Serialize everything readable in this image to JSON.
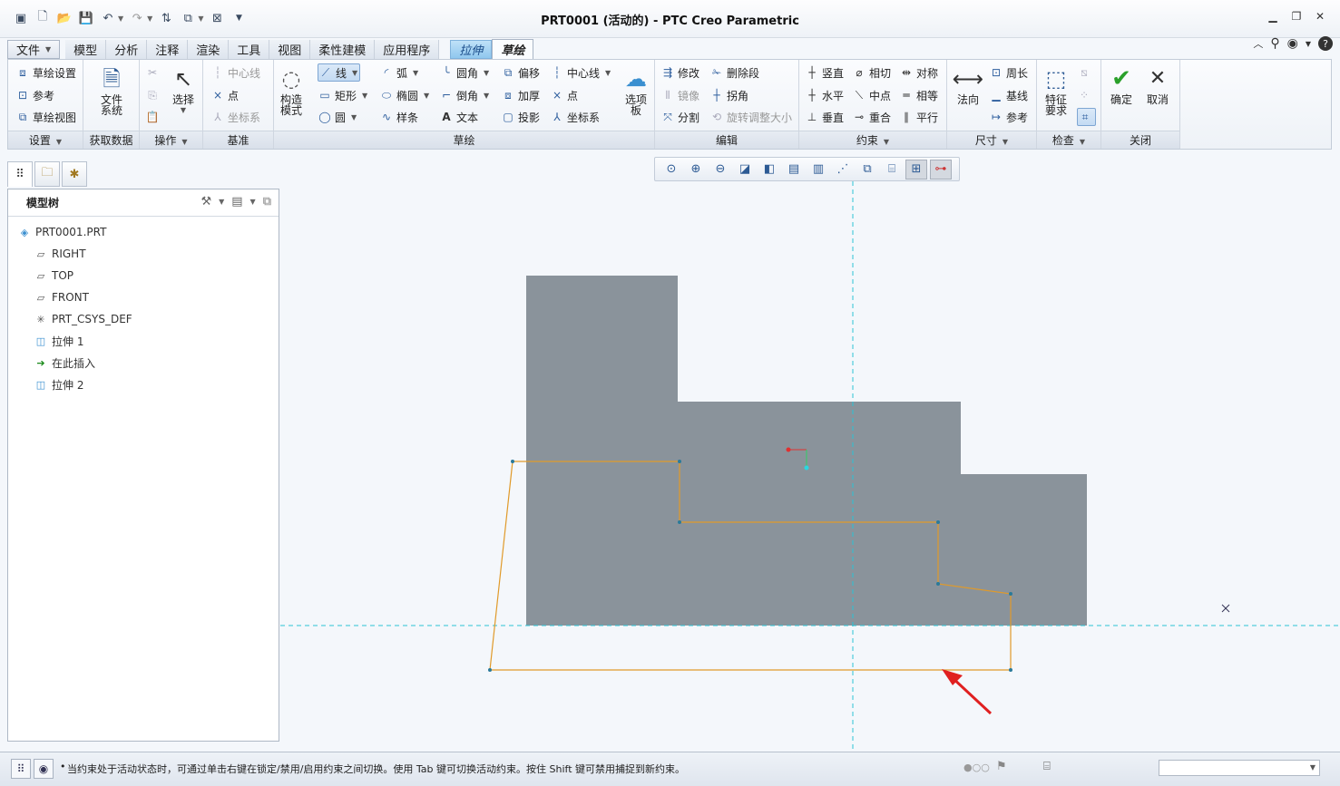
{
  "window": {
    "title": "PRT0001 (活动的) - PTC Creo Parametric"
  },
  "menu_tabs": [
    {
      "label": "文件",
      "dropdown": true
    },
    {
      "label": "模型"
    },
    {
      "label": "分析"
    },
    {
      "label": "注释"
    },
    {
      "label": "渲染"
    },
    {
      "label": "工具"
    },
    {
      "label": "视图"
    },
    {
      "label": "柔性建模"
    },
    {
      "label": "应用程序"
    },
    {
      "label": "拉伸",
      "contextual": true
    },
    {
      "label": "草绘",
      "active": true
    }
  ],
  "ribbon": {
    "setup": {
      "label": "设置",
      "items": [
        "草绘设置",
        "参考",
        "草绘视图"
      ]
    },
    "get_data": {
      "label": "获取数据",
      "file_system_l1": "文件",
      "file_system_l2": "系统"
    },
    "operations": {
      "label": "操作",
      "select_label": "选择"
    },
    "datum": {
      "label": "基准",
      "items": [
        "中心线",
        "点",
        "坐标系"
      ]
    },
    "sketching": {
      "label": "草绘",
      "construction_mode_l1": "构造",
      "construction_mode_l2": "模式",
      "col1": [
        "线",
        "矩形",
        "圆"
      ],
      "col2": [
        "弧",
        "椭圆",
        "样条"
      ],
      "col3": [
        "圆角",
        "倒角",
        "文本"
      ],
      "col4": [
        "偏移",
        "加厚",
        "投影"
      ],
      "col5": [
        "中心线",
        "点",
        "坐标系"
      ],
      "palette_l1": "选项",
      "palette_l2": "板"
    },
    "editing": {
      "label": "编辑",
      "items": [
        "修改",
        "删除段",
        "镜像",
        "拐角",
        "分割",
        "旋转调整大小"
      ]
    },
    "constrain": {
      "label": "约束",
      "items": [
        "竖直",
        "相切",
        "对称",
        "水平",
        "中点",
        "相等",
        "垂直",
        "重合",
        "平行"
      ]
    },
    "dimension": {
      "label": "尺寸",
      "normal": "法向",
      "items": [
        "周长",
        "基线",
        "参考"
      ]
    },
    "inspect": {
      "label": "检查",
      "feature_req_l1": "特征",
      "feature_req_l2": "要求"
    },
    "close": {
      "label": "关闭",
      "ok": "确定",
      "cancel": "取消"
    }
  },
  "model_tree": {
    "title": "模型树",
    "items": [
      {
        "label": "PRT0001.PRT",
        "icon": "part-icon"
      },
      {
        "label": "RIGHT",
        "icon": "datum-plane-icon"
      },
      {
        "label": "TOP",
        "icon": "datum-plane-icon"
      },
      {
        "label": "FRONT",
        "icon": "datum-plane-icon"
      },
      {
        "label": "PRT_CSYS_DEF",
        "icon": "csys-icon"
      },
      {
        "label": "拉伸 1",
        "icon": "extrude-icon"
      },
      {
        "label": "在此插入",
        "icon": "insert-here-arrow-icon"
      },
      {
        "label": "拉伸 2",
        "icon": "extrude-new-icon"
      }
    ]
  },
  "status": {
    "message": "当约束处于活动状态时，可通过单击右键在锁定/禁用/启用约束之间切换。使用 Tab 键可切换活动约束。按住 Shift 键可禁用捕捉到新约束。"
  },
  "colors": {
    "solid_fill": "#8a939b",
    "sketch_line": "#e09a2a",
    "datum_axis": "#2bc3d4",
    "annotation_arrow": "#e02020",
    "accent_blue": "#2c5a94"
  }
}
